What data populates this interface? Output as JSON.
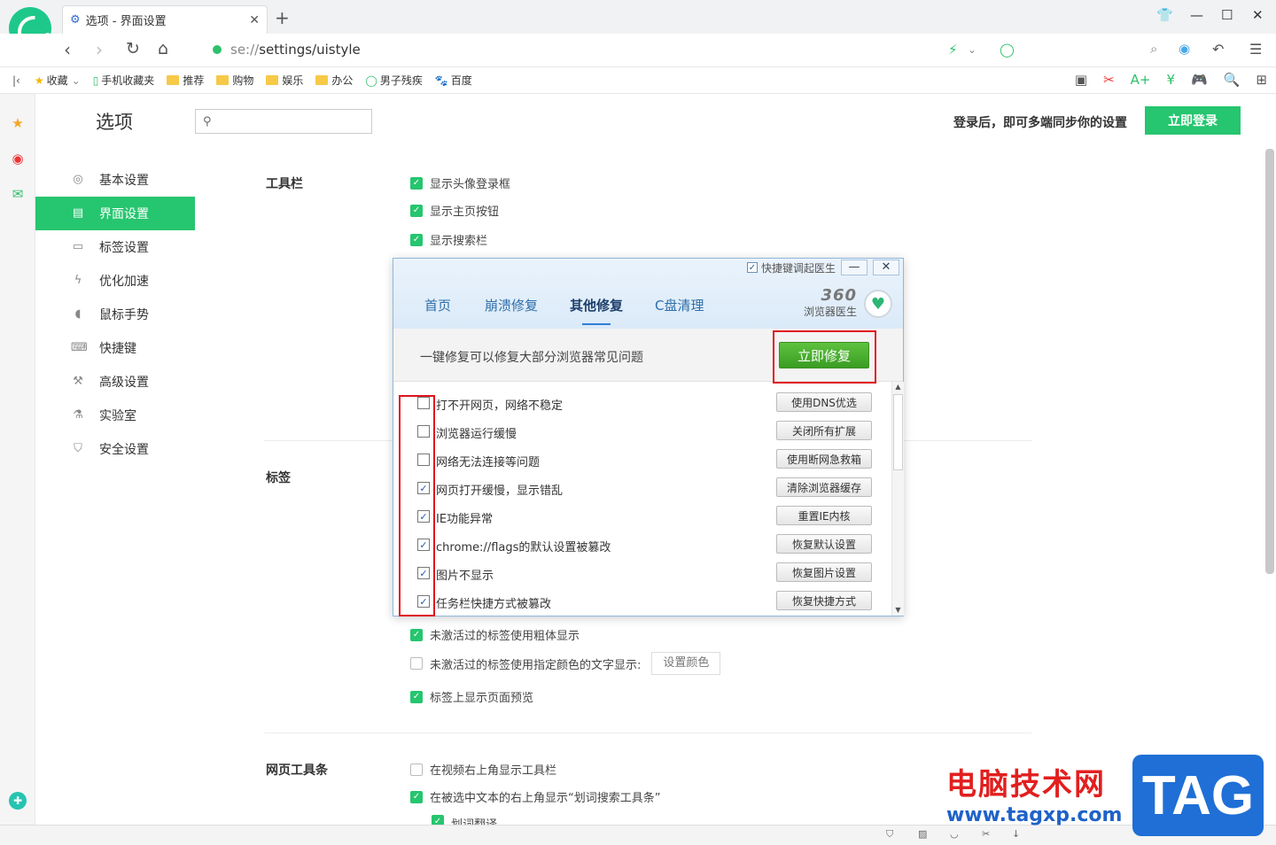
{
  "tab": {
    "title": "选项 - 界面设置"
  },
  "nav": {
    "url_scheme": "se://",
    "url_path": "settings/uistyle"
  },
  "bookmarks": [
    {
      "label": "收藏",
      "icon": "star-icon"
    },
    {
      "label": "手机收藏夹",
      "icon": "phone-icon"
    },
    {
      "label": "推荐",
      "icon": "folder-icon"
    },
    {
      "label": "购物",
      "icon": "folder-icon"
    },
    {
      "label": "娱乐",
      "icon": "folder-icon"
    },
    {
      "label": "办公",
      "icon": "folder-icon"
    },
    {
      "label": "男子残疾",
      "icon": "ring-icon"
    },
    {
      "label": "百度",
      "icon": "baidu-paw-icon"
    }
  ],
  "header": {
    "title": "选项",
    "search_placeholder": "",
    "login_hint": "登录后，即可多端同步你的设置",
    "login_button": "立即登录"
  },
  "sidebar": {
    "items": [
      {
        "label": "基本设置",
        "icon": "target-icon"
      },
      {
        "label": "界面设置",
        "icon": "window-icon"
      },
      {
        "label": "标签设置",
        "icon": "tab-icon"
      },
      {
        "label": "优化加速",
        "icon": "bolt-icon"
      },
      {
        "label": "鼠标手势",
        "icon": "mouse-icon"
      },
      {
        "label": "快捷键",
        "icon": "keyboard-icon"
      },
      {
        "label": "高级设置",
        "icon": "wrench-icon"
      },
      {
        "label": "实验室",
        "icon": "flask-icon"
      },
      {
        "label": "安全设置",
        "icon": "shield-icon"
      }
    ]
  },
  "sections": {
    "toolbar": {
      "title": "工具栏",
      "options": [
        {
          "label": "显示头像登录框",
          "checked": true
        },
        {
          "label": "显示主页按钮",
          "checked": true
        },
        {
          "label": "显示搜索栏",
          "checked": true
        }
      ]
    },
    "tabs": {
      "title": "标签",
      "options": [
        {
          "label": "未激活过的标签使用粗体显示",
          "checked": true
        },
        {
          "label": "未激活过的标签使用指定颜色的文字显示:",
          "checked": false
        },
        {
          "label": "标签上显示页面预览",
          "checked": true
        }
      ],
      "color_button": "设置颜色"
    },
    "webtoolbar": {
      "title": "网页工具条",
      "options": [
        {
          "label": "在视频右上角显示工具栏",
          "checked": false
        },
        {
          "label": "在被选中文本的右上角显示“划词搜索工具条”",
          "checked": true
        },
        {
          "label": "划词翻译",
          "checked": true
        }
      ]
    }
  },
  "dialog": {
    "shortcut_label": "快捷键调起医生",
    "shortcut_checked": true,
    "tabs": [
      "首页",
      "崩溃修复",
      "其他修复",
      "C盘清理"
    ],
    "active_tab": "其他修复",
    "brand_number": "360",
    "brand_text": "浏览器医生",
    "fix_text": "一键修复可以修复大部分浏览器常见问题",
    "fix_button": "立即修复",
    "items": [
      {
        "label": "打不开网页，网络不稳定",
        "action": "使用DNS优选",
        "checked": false
      },
      {
        "label": "浏览器运行缓慢",
        "action": "关闭所有扩展",
        "checked": false
      },
      {
        "label": "网络无法连接等问题",
        "action": "使用断网急救箱",
        "checked": false
      },
      {
        "label": "网页打开缓慢，显示错乱",
        "action": "清除浏览器缓存",
        "checked": true
      },
      {
        "label": "IE功能异常",
        "action": "重置IE内核",
        "checked": true
      },
      {
        "label": "chrome://flags的默认设置被篡改",
        "action": "恢复默认设置",
        "checked": true
      },
      {
        "label": "图片不显示",
        "action": "恢复图片设置",
        "checked": true
      },
      {
        "label": "任务栏快捷方式被篡改",
        "action": "恢复快捷方式",
        "checked": true
      }
    ]
  },
  "watermark": {
    "line1": "电脑技术网",
    "line2": "www.tagxp.com",
    "tag": "TAG"
  },
  "colors": {
    "accent": "#26c56f",
    "highlight": "#e0141e",
    "dialog_blue": "#2e6ea8"
  }
}
